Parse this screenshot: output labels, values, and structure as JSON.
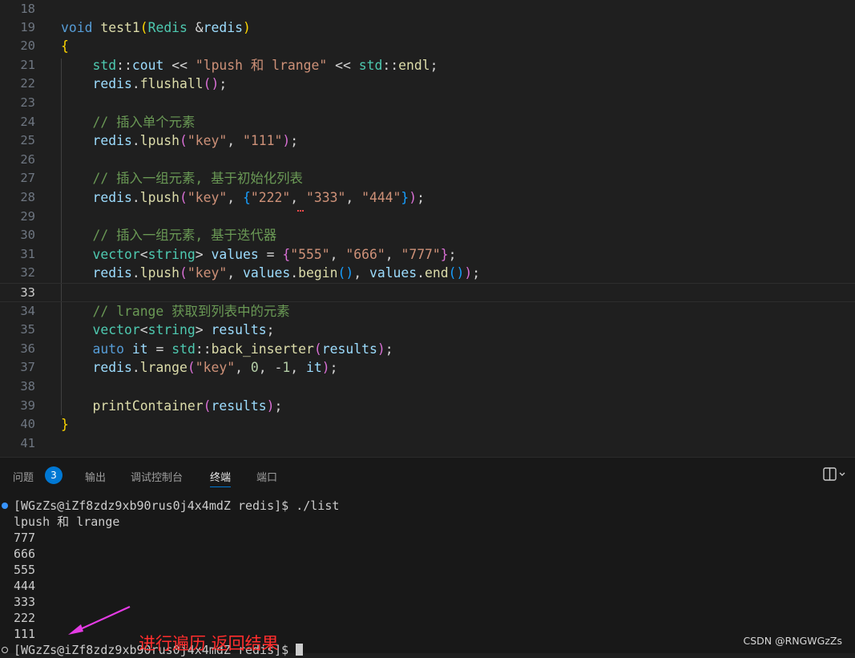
{
  "editor": {
    "line_numbers": [
      "18",
      "19",
      "20",
      "21",
      "22",
      "23",
      "24",
      "25",
      "26",
      "27",
      "28",
      "29",
      "30",
      "31",
      "32",
      "33",
      "34",
      "35",
      "36",
      "37",
      "38",
      "39",
      "40",
      "41"
    ],
    "current_line": "33",
    "comments": {
      "insert_single": "// 插入单个元素",
      "insert_initializer_list": "// 插入一组元素, 基于初始化列表",
      "insert_iterator": "// 插入一组元素, 基于迭代器",
      "lrange_fetch": "// lrange 获取到列表中的元素"
    },
    "strings": {
      "lpush_lrange": "\"lpush 和 lrange\"",
      "key": "\"key\"",
      "v111": "\"111\"",
      "v222": "\"222\"",
      "v333": "\"333\"",
      "v444": "\"444\"",
      "v555": "\"555\"",
      "v666": "\"666\"",
      "v777": "\"777\""
    }
  },
  "panel": {
    "tabs": [
      {
        "label": "问题",
        "badge": "3"
      },
      {
        "label": "输出"
      },
      {
        "label": "调试控制台"
      },
      {
        "label": "终端"
      },
      {
        "label": "端口"
      }
    ],
    "active_tab": "终端"
  },
  "terminal": {
    "lines": [
      "[WGzZs@iZf8zdz9xb90rus0j4x4mdZ redis]$ ./list",
      "lpush 和 lrange",
      "777",
      "666",
      "555",
      "444",
      "333",
      "222",
      "111",
      "[WGzZs@iZf8zdz9xb90rus0j4x4mdZ redis]$ "
    ]
  },
  "annotation": {
    "text": "进行遍历 返回结果",
    "color": "#ff2d2d",
    "arrow_color": "#e43be4"
  },
  "watermark": "CSDN @RNGWGzZs"
}
